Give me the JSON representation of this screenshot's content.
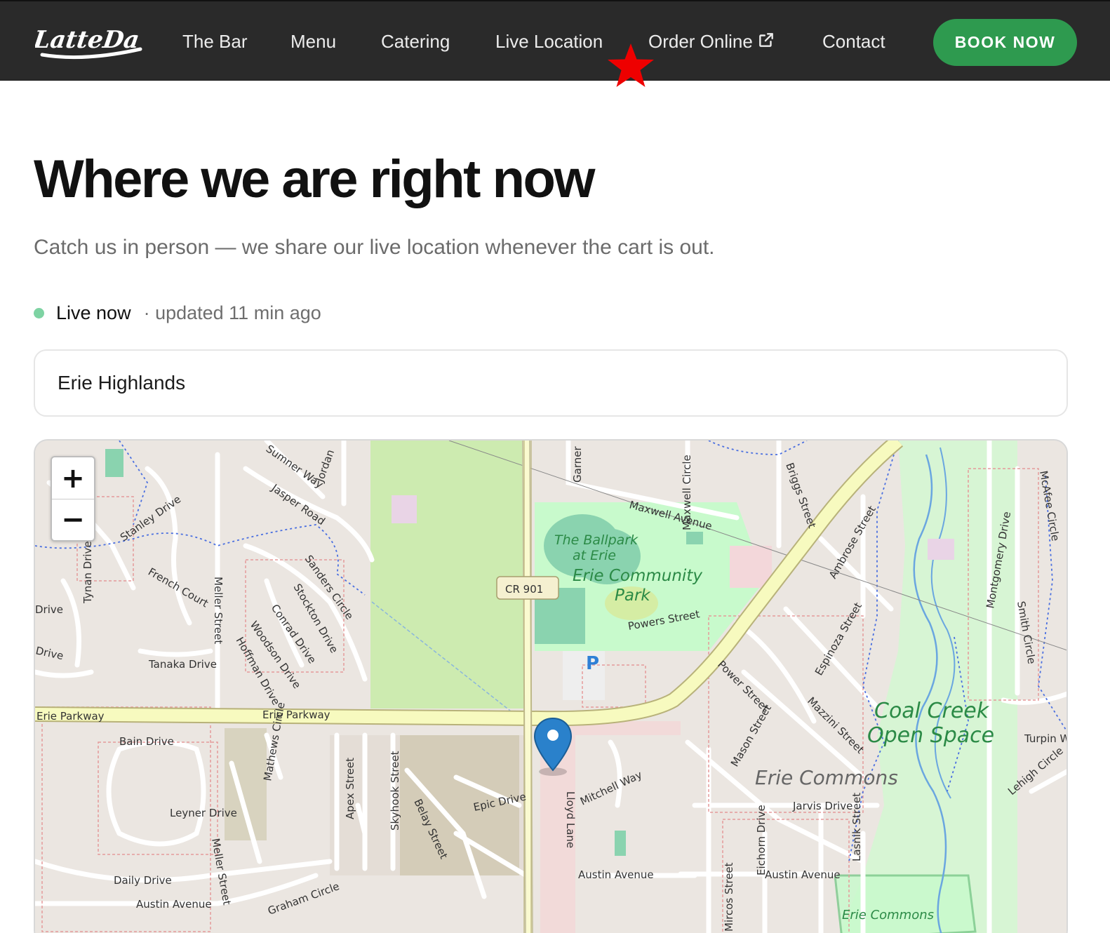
{
  "nav": {
    "brand": "LatteDa",
    "links": [
      {
        "label": "The Bar"
      },
      {
        "label": "Menu"
      },
      {
        "label": "Catering"
      },
      {
        "label": "Live Location"
      },
      {
        "label": "Order Online",
        "icon": "external-link-icon"
      },
      {
        "label": "Contact"
      }
    ],
    "book_label": "BOOK NOW",
    "book_color": "#2e9a4f",
    "marker_icon": "red-star-icon"
  },
  "hero": {
    "title": "Where we are right now",
    "subtitle": "Catch us in person — we share our live location whenever the cart is out."
  },
  "status": {
    "live_label": "Live now",
    "updated_text": "· updated 11 min ago",
    "dot_color": "#7ed3a3"
  },
  "location": {
    "name": "Erie Highlands"
  },
  "map": {
    "zoom_in": "+",
    "zoom_out": "−",
    "pin_icon": "map-pin-icon",
    "labels": {
      "erie_parkway_w": "Erie Parkway",
      "erie_parkway_c": "Erie Parkway",
      "cr901": "CR 901",
      "ballpark_1": "The Ballpark",
      "ballpark_2": "at Erie",
      "park_1": "Erie Community",
      "park_2": "Park",
      "parking": "P",
      "coal_1": "Coal Creek",
      "coal_2": "Open Space",
      "erie_commons": "Erie Commons",
      "erie_commons_s": "Erie Commons",
      "stanley": "Stanley Drive",
      "tynan": "Tynan Drive",
      "french": "French Court",
      "meller": "Meller Street",
      "meller_s": "Meller Street",
      "sumner": "Sumner Way",
      "jasper": "Jasper Road",
      "jordan": "Jordan",
      "sanders": "Sanders Circle",
      "stockton": "Stockton Drive",
      "conrad": "Conrad Drive",
      "woodson": "Woodson Drive",
      "hoffman": "Hoffman Drive",
      "tanaka": "Tanaka Drive",
      "drive1": "Drive",
      "drive2": "Drive",
      "garner": "Garner",
      "maxwell_ave": "Maxwell Avenue",
      "maxwell_cir": "Maxwell Circle",
      "briggs": "Briggs Street",
      "ambrose": "Ambrose Street",
      "powers": "Powers Street",
      "power": "Power Street",
      "espinoza": "Espinoza Street",
      "mazzini": "Mazzini Street",
      "mason": "Mason Street",
      "montgomery": "Montgomery Drive",
      "smith": "Smith Circle",
      "mcafee": "McAfee Circle",
      "turpin": "Turpin W",
      "lehigh": "Lehigh Circle",
      "bain": "Bain Drive",
      "mathews": "Mathews Circle",
      "leyner": "Leyner Drive",
      "daily": "Daily Drive",
      "austin_w": "Austin Avenue",
      "austin_c": "Austin Avenue",
      "austin_e": "Austin Avenue",
      "graham": "Graham Circle",
      "apex": "Apex Street",
      "skyhook": "Skyhook Street",
      "belay": "Belay Street",
      "epic": "Epic Drive",
      "lloyd": "Lloyd Lane",
      "mitchell": "Mitchell Way",
      "jarvis": "Jarvis Drive",
      "eichorn": "Eichorn Drive",
      "lasnik": "Lasnik Street",
      "mircos": "Mircos Street"
    }
  }
}
